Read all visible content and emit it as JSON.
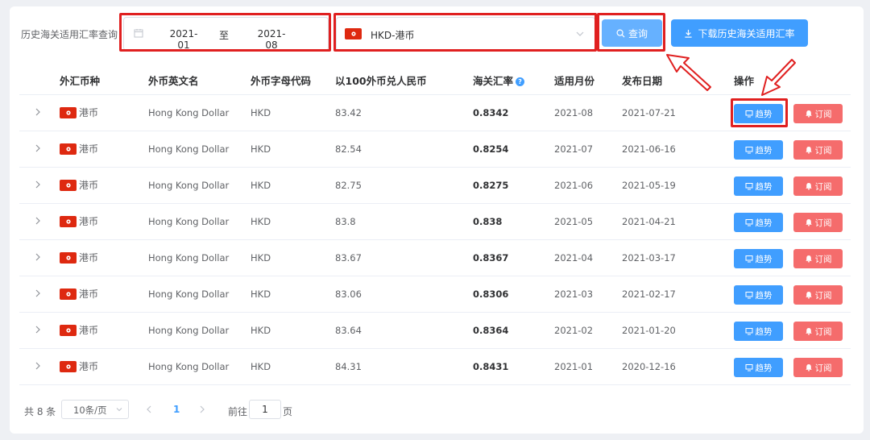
{
  "filter": {
    "label": "历史海关适用汇率查询",
    "start": "2021-01",
    "separator": "至",
    "end": "2021-08",
    "currency": "HKD-港币",
    "query_label": "查询",
    "download_label": "下载历史海关适用汇率"
  },
  "columns": {
    "currency": "外汇币种",
    "english": "外币英文名",
    "code": "外币字母代码",
    "rate100": "以100外币兑人民币",
    "customs": "海关汇率",
    "month": "适用月份",
    "date": "发布日期",
    "action": "操作"
  },
  "rows": [
    {
      "currency": "港币",
      "english": "Hong Kong Dollar",
      "code": "HKD",
      "rate100": "83.42",
      "customs": "0.8342",
      "month": "2021-08",
      "date": "2021-07-21"
    },
    {
      "currency": "港币",
      "english": "Hong Kong Dollar",
      "code": "HKD",
      "rate100": "82.54",
      "customs": "0.8254",
      "month": "2021-07",
      "date": "2021-06-16"
    },
    {
      "currency": "港币",
      "english": "Hong Kong Dollar",
      "code": "HKD",
      "rate100": "82.75",
      "customs": "0.8275",
      "month": "2021-06",
      "date": "2021-05-19"
    },
    {
      "currency": "港币",
      "english": "Hong Kong Dollar",
      "code": "HKD",
      "rate100": "83.8",
      "customs": "0.838",
      "month": "2021-05",
      "date": "2021-04-21"
    },
    {
      "currency": "港币",
      "english": "Hong Kong Dollar",
      "code": "HKD",
      "rate100": "83.67",
      "customs": "0.8367",
      "month": "2021-04",
      "date": "2021-03-17"
    },
    {
      "currency": "港币",
      "english": "Hong Kong Dollar",
      "code": "HKD",
      "rate100": "83.06",
      "customs": "0.8306",
      "month": "2021-03",
      "date": "2021-02-17"
    },
    {
      "currency": "港币",
      "english": "Hong Kong Dollar",
      "code": "HKD",
      "rate100": "83.64",
      "customs": "0.8364",
      "month": "2021-02",
      "date": "2021-01-20"
    },
    {
      "currency": "港币",
      "english": "Hong Kong Dollar",
      "code": "HKD",
      "rate100": "84.31",
      "customs": "0.8431",
      "month": "2021-01",
      "date": "2020-12-16"
    }
  ],
  "actions": {
    "trend": "趋势",
    "subscribe": "订阅"
  },
  "pager": {
    "total": "共 8 条",
    "size": "10条/页",
    "current": "1",
    "goto_prefix": "前往",
    "goto_value": "1",
    "goto_suffix": "页"
  },
  "icons": {
    "flag": "hong-kong-flag-icon",
    "calendar": "calendar-icon",
    "search": "search-icon",
    "download": "download-icon",
    "trend": "chart-icon",
    "bell": "bell-icon"
  },
  "colors": {
    "primary": "#409eff",
    "danger": "#f56c6c",
    "highlight": "#e02020"
  }
}
